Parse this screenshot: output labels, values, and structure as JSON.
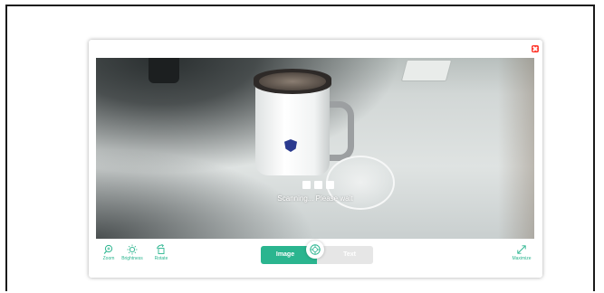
{
  "scanner": {
    "status_text": "Scanning... Please wait",
    "tools": {
      "zoom": "Zoom",
      "brightness": "Brightness",
      "rotate": "Rotate",
      "maximize": "Maximize"
    },
    "modes": {
      "image": "Image",
      "text": "Text",
      "selected": "Image"
    }
  },
  "colors": {
    "accent": "#2bb58f",
    "close": "#ff3b30",
    "inactive_mode": "#e6e6e6"
  },
  "icons": [
    "close-icon",
    "zoom-icon",
    "brightness-icon",
    "rotate-icon",
    "scan-icon",
    "maximize-icon"
  ]
}
